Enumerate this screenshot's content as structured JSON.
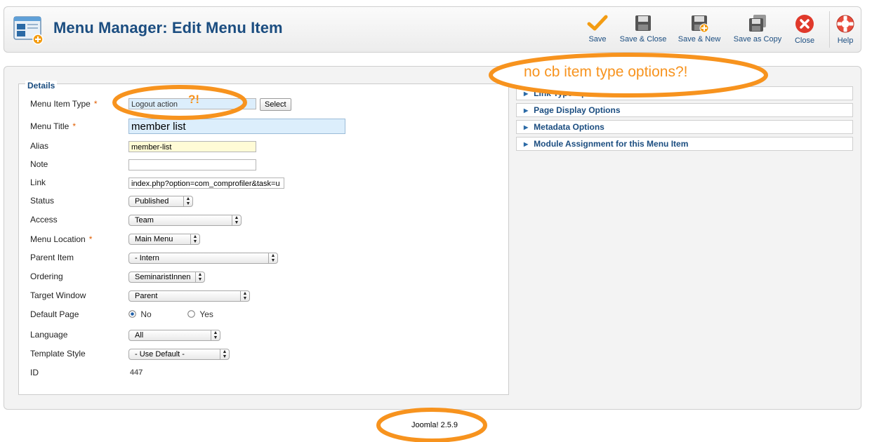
{
  "header": {
    "title": "Menu Manager: Edit Menu Item",
    "buttons": [
      {
        "label": "Save",
        "icon": "check-icon"
      },
      {
        "label": "Save & Close",
        "icon": "floppy-icon"
      },
      {
        "label": "Save & New",
        "icon": "floppy-plus-icon"
      },
      {
        "label": "Save as Copy",
        "icon": "floppy-copy-icon"
      },
      {
        "label": "Close",
        "icon": "close-icon"
      },
      {
        "label": "Help",
        "icon": "lifebuoy-icon"
      }
    ]
  },
  "details": {
    "legend": "Details",
    "menu_item_type": {
      "label": "Menu Item Type",
      "value": "Logout action",
      "button": "Select"
    },
    "menu_title": {
      "label": "Menu Title",
      "value": "member list"
    },
    "alias": {
      "label": "Alias",
      "value": "member-list"
    },
    "note": {
      "label": "Note",
      "value": ""
    },
    "link": {
      "label": "Link",
      "value": "index.php?option=com_comprofiler&task=u"
    },
    "status": {
      "label": "Status",
      "value": "Published"
    },
    "access": {
      "label": "Access",
      "value": "Team"
    },
    "menu_location": {
      "label": "Menu Location",
      "value": "Main Menu"
    },
    "parent_item": {
      "label": "Parent Item",
      "value": "- Intern"
    },
    "ordering": {
      "label": "Ordering",
      "value": "SeminaristInnen"
    },
    "target_window": {
      "label": "Target Window",
      "value": "Parent"
    },
    "default_page": {
      "label": "Default Page",
      "options": [
        "No",
        "Yes"
      ],
      "selected": "No"
    },
    "language": {
      "label": "Language",
      "value": "All"
    },
    "template_style": {
      "label": "Template Style",
      "value": "- Use Default -"
    },
    "id": {
      "label": "ID",
      "value": "447"
    },
    "required_mark": "*"
  },
  "panels": [
    "Link Type Options",
    "Page Display Options",
    "Metadata Options",
    "Module Assignment for this Menu Item"
  ],
  "annotations": {
    "top_note": "no cb item type options?!",
    "type_note": "?!"
  },
  "footer": {
    "version": "Joomla! 2.5.9"
  },
  "colors": {
    "accent": "#1b4d80",
    "annotation": "#f7931e",
    "required": "#e05d00"
  }
}
